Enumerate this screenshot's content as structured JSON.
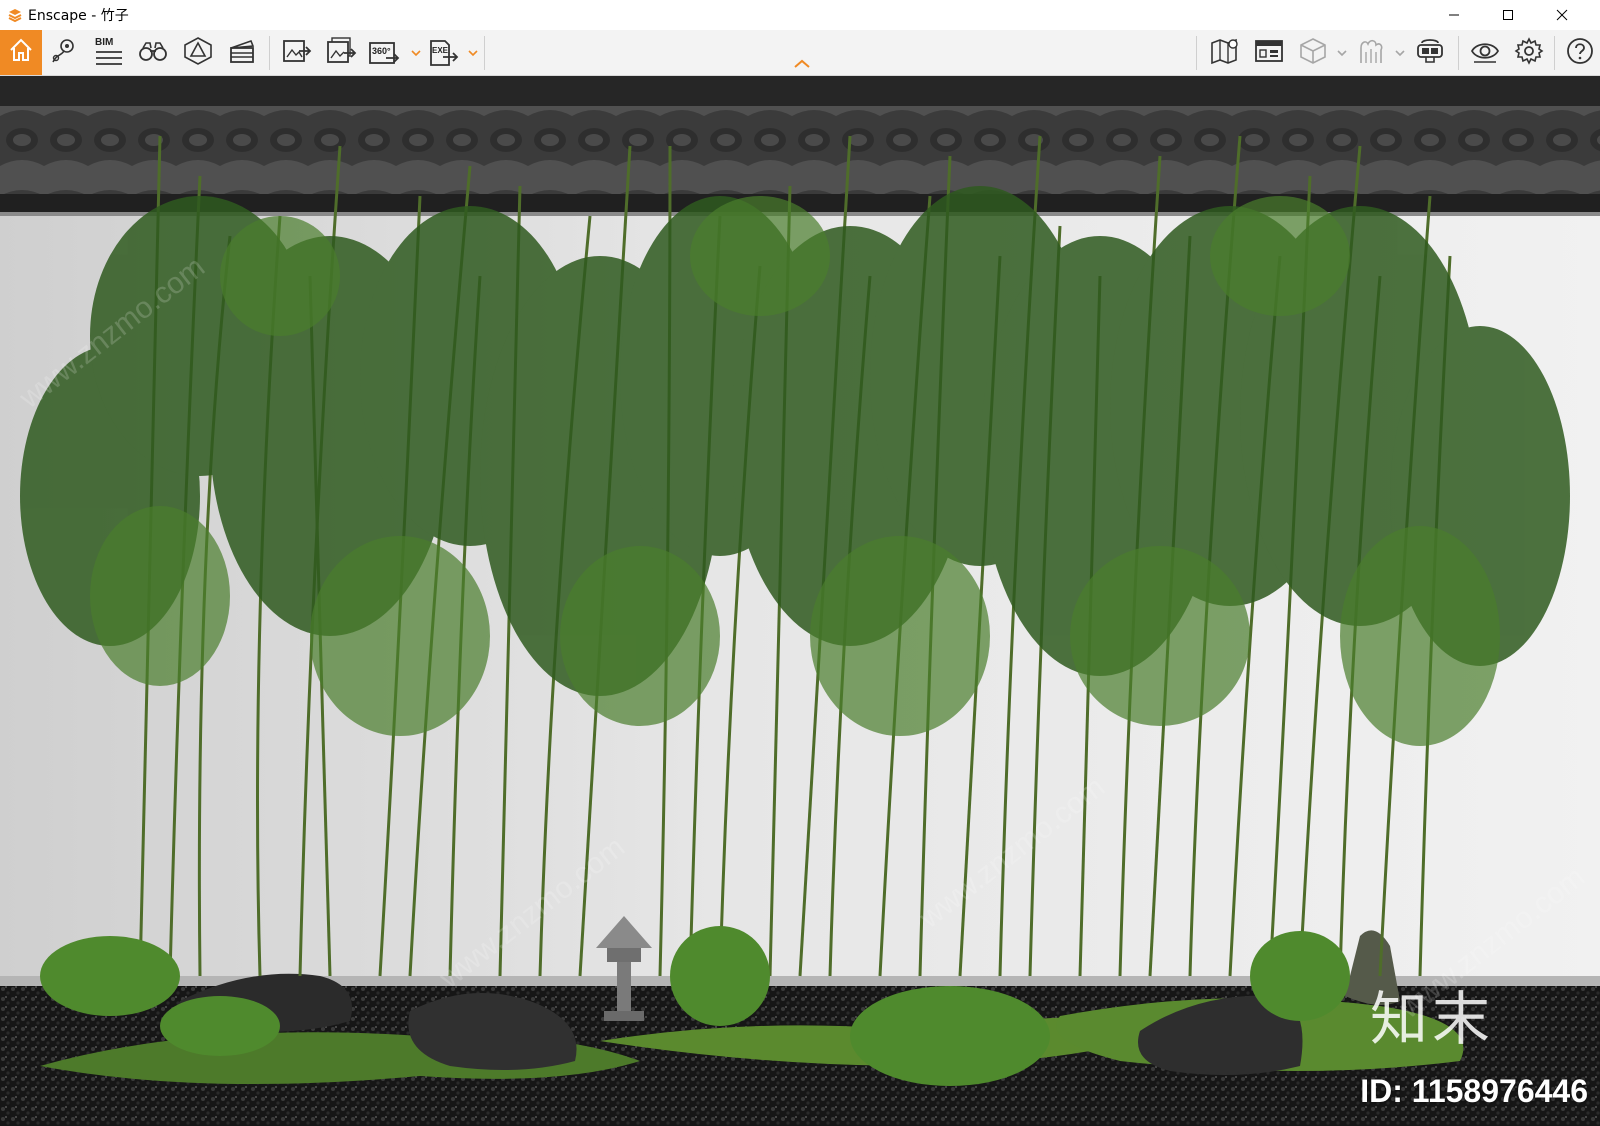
{
  "window": {
    "title": "Enscape - 竹子",
    "app_icon": "enscape-logo-icon",
    "controls": [
      "minimize-icon",
      "maximize-icon",
      "close-icon"
    ]
  },
  "toolbar": {
    "accent_color": "#f08a24",
    "left_buttons": [
      {
        "name": "home",
        "icon": "home-icon",
        "active": true
      },
      {
        "name": "views",
        "icon": "location-pin-icon"
      },
      {
        "name": "bim",
        "icon": "bim-list-icon",
        "label": "BIM"
      },
      {
        "name": "walk-mode",
        "icon": "binoculars-icon"
      },
      {
        "name": "atmosphere",
        "icon": "triangle-cube-icon"
      },
      {
        "name": "video-editor",
        "icon": "clapperboard-icon"
      },
      {
        "name": "screenshot-export",
        "icon": "image-export-icon"
      },
      {
        "name": "batch-export",
        "icon": "batch-export-icon"
      },
      {
        "name": "panorama-export",
        "icon": "panorama-export-icon",
        "label": "360°",
        "has_dropdown": true
      },
      {
        "name": "exe-export",
        "icon": "exe-export-icon",
        "label": "EXE",
        "has_dropdown": true
      }
    ],
    "right_buttons": [
      {
        "name": "map",
        "icon": "map-pin-icon"
      },
      {
        "name": "asset-library",
        "icon": "asset-library-icon"
      },
      {
        "name": "material-cube",
        "icon": "cube-icon",
        "has_dropdown": true,
        "disabled": true
      },
      {
        "name": "upload",
        "icon": "cloud-upload-icon",
        "has_dropdown": true,
        "disabled": true
      },
      {
        "name": "vr-headset",
        "icon": "vr-headset-icon"
      },
      {
        "name": "visual-settings",
        "icon": "eye-icon"
      },
      {
        "name": "general-settings",
        "icon": "gear-icon"
      },
      {
        "name": "help",
        "icon": "question-icon"
      }
    ],
    "collapse_icon": "chevron-up-icon"
  },
  "viewport": {
    "scene": "bamboo-garden-render",
    "watermark_logo": "知末",
    "watermark_id": "ID: 1158976446",
    "watermark_pattern": "www.znzmo.com"
  }
}
